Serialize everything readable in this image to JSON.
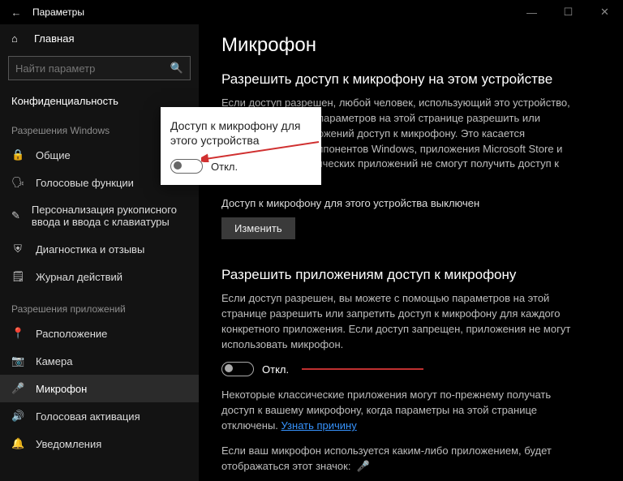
{
  "titlebar": {
    "title": "Параметры"
  },
  "sidebar": {
    "home": "Главная",
    "search_placeholder": "Найти параметр",
    "section": "Конфиденциальность",
    "group_windows": "Разрешения Windows",
    "group_apps": "Разрешения приложений",
    "items_windows": [
      {
        "icon": "🔒",
        "label": "Общие"
      },
      {
        "icon": "🗣",
        "label": "Голосовые функции"
      },
      {
        "icon": "✎",
        "label": "Персонализация рукописного ввода и ввода с клавиатуры"
      },
      {
        "icon": "⛨",
        "label": "Диагностика и отзывы"
      },
      {
        "icon": "🗒",
        "label": "Журнал действий"
      }
    ],
    "items_apps": [
      {
        "icon": "📍",
        "label": "Расположение"
      },
      {
        "icon": "📷",
        "label": "Камера"
      },
      {
        "icon": "🎤",
        "label": "Микрофон",
        "active": true
      },
      {
        "icon": "🔊",
        "label": "Голосовая активация"
      },
      {
        "icon": "🔔",
        "label": "Уведомления"
      }
    ]
  },
  "content": {
    "h1": "Микрофон",
    "section1": {
      "title": "Разрешить доступ к микрофону на этом устройстве",
      "para": "Если доступ разрешен, любой человек, использующий это устройство, сможет с помощью параметров на этой странице разрешить или запретить для приложений доступ к микрофону. Это касается приложений для компонентов Windows, приложения Microsoft Store и большинство классических приложений не смогут получить доступ к микрофон.",
      "status": "Доступ к микрофону для этого устройства выключен",
      "button": "Изменить"
    },
    "section2": {
      "title": "Разрешить приложениям доступ к микрофону",
      "para": "Если доступ разрешен, вы можете с помощью параметров на этой странице разрешить или запретить доступ к микрофону для каждого конкретного приложения. Если доступ запрещен, приложения не могут использовать микрофон.",
      "toggle_label": "Откл.",
      "para2_a": "Некоторые классические приложения могут по-прежнему получать доступ к вашему микрофону, когда параметры на этой странице отключены. ",
      "link": "Узнать причину",
      "para3": "Если ваш микрофон используется каким-либо приложением, будет отображаться этот значок:"
    }
  },
  "popup": {
    "title": "Доступ к микрофону для этого устройства",
    "label": "Откл."
  }
}
